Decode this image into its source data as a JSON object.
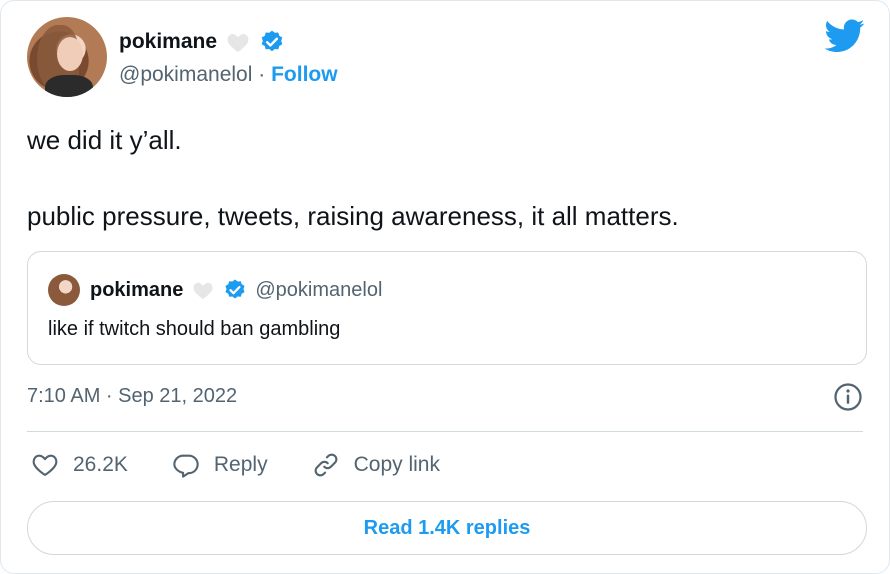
{
  "author": {
    "name": "pokimane",
    "handle": "@pokimanelol",
    "separator": "·",
    "follow_label": "Follow"
  },
  "tweet": {
    "text": "we did it y’all.\n\npublic pressure, tweets, raising awareness, it all matters.",
    "timestamp": "7:10 AM · Sep 21, 2022"
  },
  "quoted_tweet": {
    "name": "pokimane",
    "handle": "@pokimanelol",
    "text": "like if twitch should ban gambling"
  },
  "actions": {
    "likes": "26.2K",
    "reply_label": "Reply",
    "copy_link_label": "Copy link"
  },
  "read_replies_label": "Read 1.4K replies",
  "colors": {
    "accent": "#1d9bf0",
    "text": "#0f1419",
    "muted": "#536471",
    "border": "#cfd9de"
  },
  "icons": [
    "heart-badge-icon",
    "verified-icon",
    "twitter-bird-icon",
    "info-icon",
    "heart-icon",
    "reply-icon",
    "link-icon"
  ]
}
